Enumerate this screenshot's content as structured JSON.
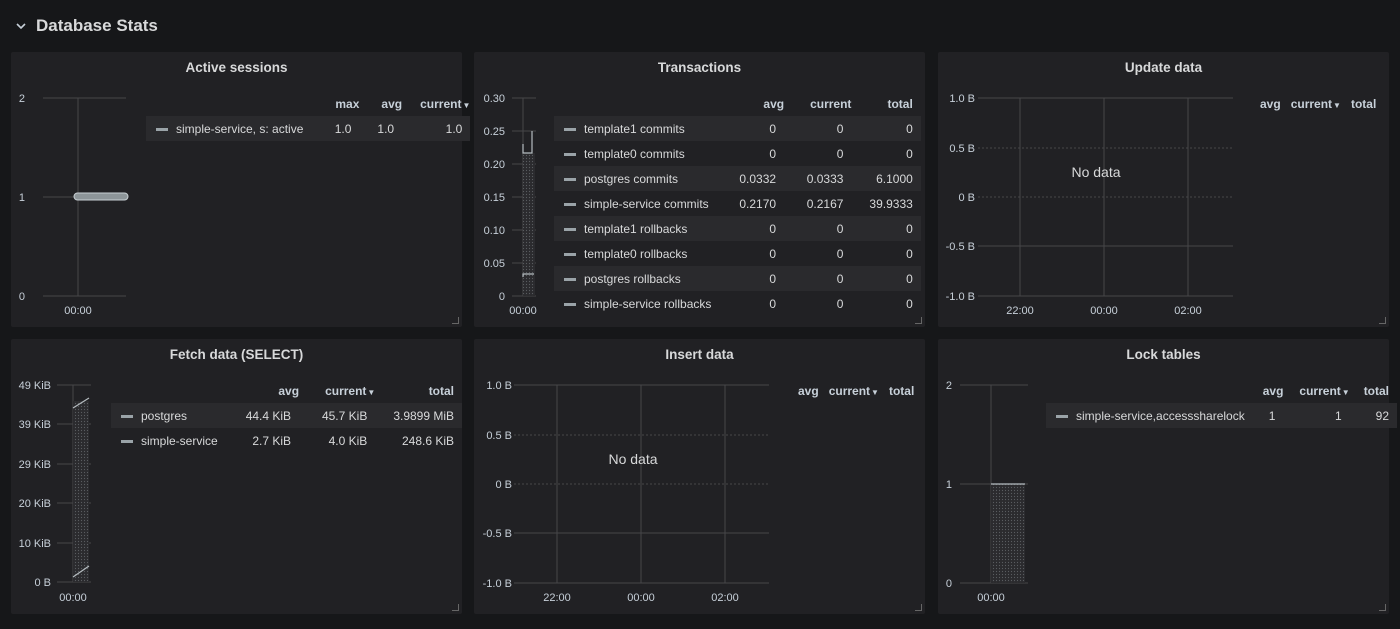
{
  "row": {
    "title": "Database Stats"
  },
  "colors": {
    "background": "#161719",
    "panel": "#212124",
    "grid": "#464649",
    "series": "#9aa3a8"
  },
  "panels": [
    {
      "title": "Active sessions",
      "y_ticks": [
        "2",
        "1",
        "0"
      ],
      "x_ticks": [
        "00:00"
      ],
      "legend_headers": [
        "max",
        "avg",
        "current"
      ],
      "legend_rows": [
        {
          "name": "simple-service, s: active",
          "values": [
            "1.0",
            "1.0",
            "1.0"
          ]
        }
      ]
    },
    {
      "title": "Transactions",
      "y_ticks": [
        "0.30",
        "0.25",
        "0.20",
        "0.15",
        "0.10",
        "0.05",
        "0"
      ],
      "x_ticks": [
        "00:00"
      ],
      "legend_headers": [
        "avg",
        "current",
        "total"
      ],
      "legend_rows": [
        {
          "name": "template1 commits",
          "values": [
            "0",
            "0",
            "0"
          ]
        },
        {
          "name": "template0 commits",
          "values": [
            "0",
            "0",
            "0"
          ]
        },
        {
          "name": "postgres commits",
          "values": [
            "0.0332",
            "0.0333",
            "6.1000"
          ]
        },
        {
          "name": "simple-service commits",
          "values": [
            "0.2170",
            "0.2167",
            "39.9333"
          ]
        },
        {
          "name": "template1 rollbacks",
          "values": [
            "0",
            "0",
            "0"
          ]
        },
        {
          "name": "template0 rollbacks",
          "values": [
            "0",
            "0",
            "0"
          ]
        },
        {
          "name": "postgres rollbacks",
          "values": [
            "0",
            "0",
            "0"
          ]
        },
        {
          "name": "simple-service rollbacks",
          "values": [
            "0",
            "0",
            "0"
          ]
        }
      ]
    },
    {
      "title": "Update data",
      "y_ticks": [
        "1.0 B",
        "0.5 B",
        "0 B",
        "-0.5 B",
        "-1.0 B"
      ],
      "x_ticks": [
        "22:00",
        "00:00",
        "02:00"
      ],
      "no_data": "No data",
      "legend_headers": [
        "avg",
        "current",
        "total"
      ],
      "legend_rows": []
    },
    {
      "title": "Fetch data (SELECT)",
      "y_ticks": [
        "49 KiB",
        "39 KiB",
        "29 KiB",
        "20 KiB",
        "10 KiB",
        "0 B"
      ],
      "x_ticks": [
        "00:00"
      ],
      "legend_headers": [
        "avg",
        "current",
        "total"
      ],
      "legend_rows": [
        {
          "name": "postgres",
          "values": [
            "44.4 KiB",
            "45.7 KiB",
            "3.9899 MiB"
          ]
        },
        {
          "name": "simple-service",
          "values": [
            "2.7 KiB",
            "4.0 KiB",
            "248.6 KiB"
          ]
        }
      ]
    },
    {
      "title": "Insert data",
      "y_ticks": [
        "1.0 B",
        "0.5 B",
        "0 B",
        "-0.5 B",
        "-1.0 B"
      ],
      "x_ticks": [
        "22:00",
        "00:00",
        "02:00"
      ],
      "no_data": "No data",
      "legend_headers": [
        "avg",
        "current",
        "total"
      ],
      "legend_rows": []
    },
    {
      "title": "Lock tables",
      "y_ticks": [
        "2",
        "1",
        "0"
      ],
      "x_ticks": [
        "00:00"
      ],
      "legend_headers": [
        "avg",
        "current",
        "total"
      ],
      "legend_rows": [
        {
          "name": "simple-service,accesssharelock",
          "values": [
            "1",
            "1",
            "92"
          ]
        }
      ]
    }
  ]
}
